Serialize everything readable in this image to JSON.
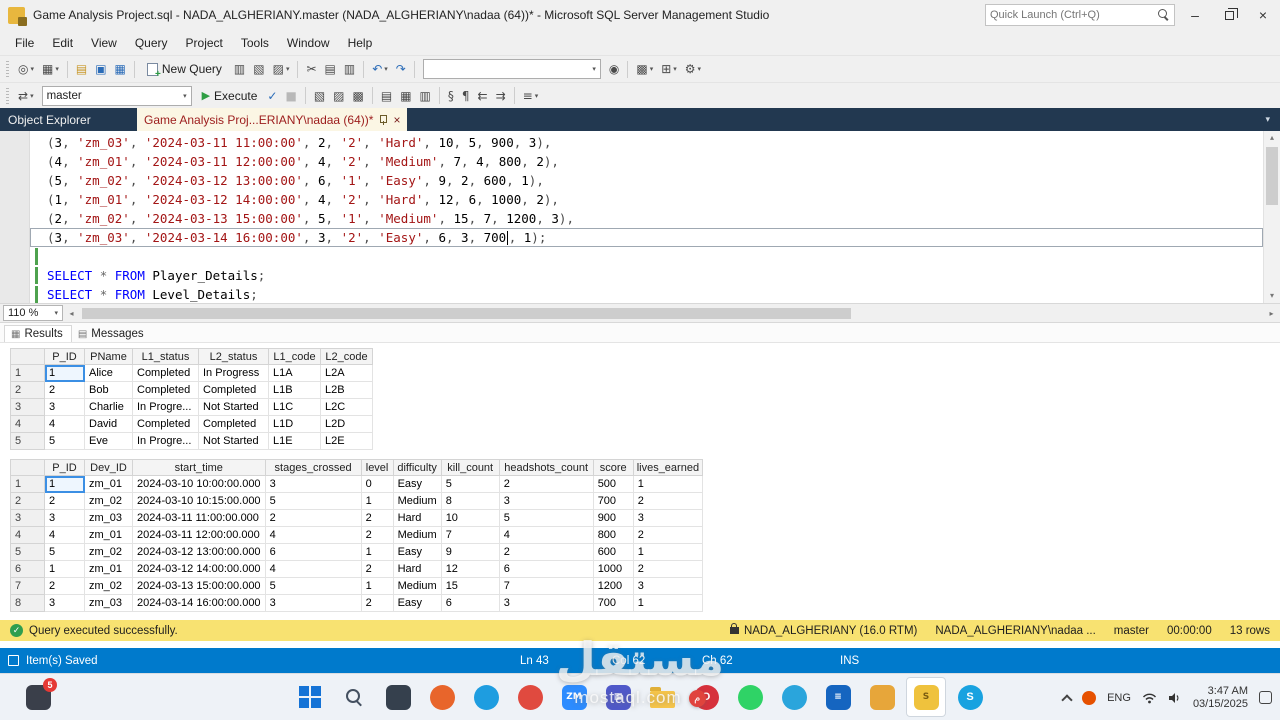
{
  "titlebar": {
    "title": "Game Analysis Project.sql - NADA_ALGHERIANY.master (NADA_ALGHERIANY\\nadaa (64))* - Microsoft SQL Server Management Studio",
    "quick_launch_placeholder": "Quick Launch (Ctrl+Q)"
  },
  "menu": {
    "items": [
      "File",
      "Edit",
      "View",
      "Query",
      "Project",
      "Tools",
      "Window",
      "Help"
    ]
  },
  "toolbar_main": {
    "new_query_label": "New Query",
    "icons_a": [
      {
        "name": "connect-icon",
        "glyph": "◎",
        "dd": true
      },
      {
        "name": "register-server-icon",
        "glyph": "▦",
        "dd": true
      },
      {
        "sep": true
      },
      {
        "name": "open-file-icon",
        "glyph": "▤",
        "color": "#c9982a"
      },
      {
        "name": "save-icon",
        "glyph": "▣",
        "color": "#2b6cb8"
      },
      {
        "name": "save-all-icon",
        "glyph": "▦",
        "color": "#2b6cb8"
      },
      {
        "sep": true
      }
    ],
    "icons_b": [
      {
        "name": "new-database-query-icon",
        "glyph": "▥"
      },
      {
        "name": "open-query-icon",
        "glyph": "▧"
      },
      {
        "name": "analysis-query-icon",
        "glyph": "▨",
        "dd": true
      },
      {
        "sep": true
      },
      {
        "name": "cut-icon",
        "glyph": "✂"
      },
      {
        "name": "copy-icon",
        "glyph": "▤"
      },
      {
        "name": "paste-icon",
        "glyph": "▥"
      },
      {
        "sep": true
      },
      {
        "name": "undo-icon",
        "glyph": "↶",
        "color": "#2b6cb8",
        "dd": true
      },
      {
        "name": "redo-icon",
        "glyph": "↷",
        "color": "#2b6cb8"
      },
      {
        "sep": true
      }
    ],
    "icons_c": [
      {
        "name": "find-icon",
        "glyph": "◉"
      },
      {
        "sep": true
      },
      {
        "name": "activity-monitor-icon",
        "glyph": "▩",
        "dd": true
      },
      {
        "name": "feature-pane-icon",
        "glyph": "⊞",
        "dd": true
      },
      {
        "name": "settings-icon",
        "glyph": "⚙",
        "dd": true
      }
    ]
  },
  "toolbar_query": {
    "database": "master",
    "execute_label": "Execute",
    "icons_a": [
      {
        "name": "available-databases-icon",
        "glyph": "⇄",
        "dd": true
      }
    ],
    "icons_b": [
      {
        "name": "parse-query-icon",
        "glyph": "✓",
        "color": "#2b6cb8"
      },
      {
        "name": "cancel-query-icon",
        "glyph": "■",
        "color": "#b8b8b8"
      },
      {
        "sep": true
      },
      {
        "name": "estimated-plan-icon",
        "glyph": "▧"
      },
      {
        "name": "live-query-stats-icon",
        "glyph": "▨"
      },
      {
        "name": "client-statistics-icon",
        "glyph": "▩"
      },
      {
        "sep": true
      },
      {
        "name": "results-to-text-icon",
        "glyph": "▤"
      },
      {
        "name": "results-to-grid-icon",
        "glyph": "▦"
      },
      {
        "name": "results-to-file-icon",
        "glyph": "▥"
      },
      {
        "sep": true
      },
      {
        "name": "comment-icon",
        "glyph": "§"
      },
      {
        "name": "uncomment-icon",
        "glyph": "¶"
      },
      {
        "name": "outdent-icon",
        "glyph": "⇇"
      },
      {
        "name": "indent-icon",
        "glyph": "⇉"
      },
      {
        "sep": true
      },
      {
        "name": "sqlcmd-mode-icon",
        "glyph": "≡",
        "dd": true
      }
    ]
  },
  "tabstrip": {
    "object_explorer": "Object Explorer",
    "document_tab": "Game Analysis Proj...ERIANY\\nadaa (64))*"
  },
  "editor": {
    "zoom": "110 %",
    "lines": [
      {
        "tokens": [
          [
            "p",
            "("
          ],
          [
            "n",
            "3"
          ],
          [
            "p",
            ", "
          ],
          [
            "s",
            "'zm_03'"
          ],
          [
            "p",
            ", "
          ],
          [
            "s",
            "'2024-03-11 11:00:00'"
          ],
          [
            "p",
            ", "
          ],
          [
            "n",
            "2"
          ],
          [
            "p",
            ", "
          ],
          [
            "s",
            "'2'"
          ],
          [
            "p",
            ", "
          ],
          [
            "s",
            "'Hard'"
          ],
          [
            "p",
            ", "
          ],
          [
            "n",
            "10"
          ],
          [
            "p",
            ", "
          ],
          [
            "n",
            "5"
          ],
          [
            "p",
            ", "
          ],
          [
            "n",
            "900"
          ],
          [
            "p",
            ", "
          ],
          [
            "n",
            "3"
          ],
          [
            "p",
            "),"
          ]
        ]
      },
      {
        "tokens": [
          [
            "p",
            "("
          ],
          [
            "n",
            "4"
          ],
          [
            "p",
            ", "
          ],
          [
            "s",
            "'zm_01'"
          ],
          [
            "p",
            ", "
          ],
          [
            "s",
            "'2024-03-11 12:00:00'"
          ],
          [
            "p",
            ", "
          ],
          [
            "n",
            "4"
          ],
          [
            "p",
            ", "
          ],
          [
            "s",
            "'2'"
          ],
          [
            "p",
            ", "
          ],
          [
            "s",
            "'Medium'"
          ],
          [
            "p",
            ", "
          ],
          [
            "n",
            "7"
          ],
          [
            "p",
            ", "
          ],
          [
            "n",
            "4"
          ],
          [
            "p",
            ", "
          ],
          [
            "n",
            "800"
          ],
          [
            "p",
            ", "
          ],
          [
            "n",
            "2"
          ],
          [
            "p",
            "),"
          ]
        ]
      },
      {
        "tokens": [
          [
            "p",
            "("
          ],
          [
            "n",
            "5"
          ],
          [
            "p",
            ", "
          ],
          [
            "s",
            "'zm_02'"
          ],
          [
            "p",
            ", "
          ],
          [
            "s",
            "'2024-03-12 13:00:00'"
          ],
          [
            "p",
            ", "
          ],
          [
            "n",
            "6"
          ],
          [
            "p",
            ", "
          ],
          [
            "s",
            "'1'"
          ],
          [
            "p",
            ", "
          ],
          [
            "s",
            "'Easy'"
          ],
          [
            "p",
            ", "
          ],
          [
            "n",
            "9"
          ],
          [
            "p",
            ", "
          ],
          [
            "n",
            "2"
          ],
          [
            "p",
            ", "
          ],
          [
            "n",
            "600"
          ],
          [
            "p",
            ", "
          ],
          [
            "n",
            "1"
          ],
          [
            "p",
            "),"
          ]
        ]
      },
      {
        "tokens": [
          [
            "p",
            "("
          ],
          [
            "n",
            "1"
          ],
          [
            "p",
            ", "
          ],
          [
            "s",
            "'zm_01'"
          ],
          [
            "p",
            ", "
          ],
          [
            "s",
            "'2024-03-12 14:00:00'"
          ],
          [
            "p",
            ", "
          ],
          [
            "n",
            "4"
          ],
          [
            "p",
            ", "
          ],
          [
            "s",
            "'2'"
          ],
          [
            "p",
            ", "
          ],
          [
            "s",
            "'Hard'"
          ],
          [
            "p",
            ", "
          ],
          [
            "n",
            "12"
          ],
          [
            "p",
            ", "
          ],
          [
            "n",
            "6"
          ],
          [
            "p",
            ", "
          ],
          [
            "n",
            "1000"
          ],
          [
            "p",
            ", "
          ],
          [
            "n",
            "2"
          ],
          [
            "p",
            "),"
          ]
        ]
      },
      {
        "tokens": [
          [
            "p",
            "("
          ],
          [
            "n",
            "2"
          ],
          [
            "p",
            ", "
          ],
          [
            "s",
            "'zm_02'"
          ],
          [
            "p",
            ", "
          ],
          [
            "s",
            "'2024-03-13 15:00:00'"
          ],
          [
            "p",
            ", "
          ],
          [
            "n",
            "5"
          ],
          [
            "p",
            ", "
          ],
          [
            "s",
            "'1'"
          ],
          [
            "p",
            ", "
          ],
          [
            "s",
            "'Medium'"
          ],
          [
            "p",
            ", "
          ],
          [
            "n",
            "15"
          ],
          [
            "p",
            ", "
          ],
          [
            "n",
            "7"
          ],
          [
            "p",
            ", "
          ],
          [
            "n",
            "1200"
          ],
          [
            "p",
            ", "
          ],
          [
            "n",
            "3"
          ],
          [
            "p",
            "),"
          ]
        ]
      },
      {
        "current": true,
        "tokens": [
          [
            "p",
            "("
          ],
          [
            "n",
            "3"
          ],
          [
            "p",
            ", "
          ],
          [
            "s",
            "'zm_03'"
          ],
          [
            "p",
            ", "
          ],
          [
            "s",
            "'2024-03-14 16:00:00'"
          ],
          [
            "p",
            ", "
          ],
          [
            "n",
            "3"
          ],
          [
            "p",
            ", "
          ],
          [
            "s",
            "'2'"
          ],
          [
            "p",
            ", "
          ],
          [
            "s",
            "'Easy'"
          ],
          [
            "p",
            ", "
          ],
          [
            "n",
            "6"
          ],
          [
            "p",
            ", "
          ],
          [
            "n",
            "3"
          ],
          [
            "p",
            ", "
          ],
          [
            "n",
            "700"
          ],
          [
            "cur",
            ""
          ],
          [
            "p",
            ", "
          ],
          [
            "n",
            "1"
          ],
          [
            "p",
            ");"
          ]
        ]
      },
      {
        "green": true,
        "tokens": []
      },
      {
        "green": true,
        "tokens": [
          [
            "k",
            "SELECT"
          ],
          [
            "w",
            " "
          ],
          [
            "o",
            "*"
          ],
          [
            "w",
            " "
          ],
          [
            "k",
            "FROM"
          ],
          [
            "i",
            " Player_Details"
          ],
          [
            "p",
            ";"
          ]
        ]
      },
      {
        "green": true,
        "tokens": [
          [
            "k",
            "SELECT"
          ],
          [
            "w",
            " "
          ],
          [
            "o",
            "*"
          ],
          [
            "w",
            " "
          ],
          [
            "k",
            "FROM"
          ],
          [
            "i",
            " Level_Details"
          ],
          [
            "p",
            ";"
          ]
        ]
      }
    ]
  },
  "results": {
    "tabs": [
      "Results",
      "Messages"
    ],
    "grid1": {
      "headers": [
        "P_ID",
        "PName",
        "L1_status",
        "L2_status",
        "L1_code",
        "L2_code"
      ],
      "rows": [
        [
          "1",
          "Alice",
          "Completed",
          "In Progress",
          "L1A",
          "L2A"
        ],
        [
          "2",
          "Bob",
          "Completed",
          "Completed",
          "L1B",
          "L2B"
        ],
        [
          "3",
          "Charlie",
          "In Progre...",
          "Not Started",
          "L1C",
          "L2C"
        ],
        [
          "4",
          "David",
          "Completed",
          "Completed",
          "L1D",
          "L2D"
        ],
        [
          "5",
          "Eve",
          "In Progre...",
          "Not Started",
          "L1E",
          "L2E"
        ]
      ]
    },
    "grid2": {
      "headers": [
        "P_ID",
        "Dev_ID",
        "start_time",
        "stages_crossed",
        "level",
        "difficulty",
        "kill_count",
        "headshots_count",
        "score",
        "lives_earned"
      ],
      "rows": [
        [
          "1",
          "zm_01",
          "2024-03-10 10:00:00.000",
          "3",
          "0",
          "Easy",
          "5",
          "2",
          "500",
          "1"
        ],
        [
          "2",
          "zm_02",
          "2024-03-10 10:15:00.000",
          "5",
          "1",
          "Medium",
          "8",
          "3",
          "700",
          "2"
        ],
        [
          "3",
          "zm_03",
          "2024-03-11 11:00:00.000",
          "2",
          "2",
          "Hard",
          "10",
          "5",
          "900",
          "3"
        ],
        [
          "4",
          "zm_01",
          "2024-03-11 12:00:00.000",
          "4",
          "2",
          "Medium",
          "7",
          "4",
          "800",
          "2"
        ],
        [
          "5",
          "zm_02",
          "2024-03-12 13:00:00.000",
          "6",
          "1",
          "Easy",
          "9",
          "2",
          "600",
          "1"
        ],
        [
          "1",
          "zm_01",
          "2024-03-12 14:00:00.000",
          "4",
          "2",
          "Hard",
          "12",
          "6",
          "1000",
          "2"
        ],
        [
          "2",
          "zm_02",
          "2024-03-13 15:00:00.000",
          "5",
          "1",
          "Medium",
          "15",
          "7",
          "1200",
          "3"
        ],
        [
          "3",
          "zm_03",
          "2024-03-14 16:00:00.000",
          "3",
          "2",
          "Easy",
          "6",
          "3",
          "700",
          "1"
        ]
      ]
    }
  },
  "status_yellow": {
    "message": "Query executed successfully.",
    "server": "NADA_ALGHERIANY (16.0 RTM)",
    "user": "NADA_ALGHERIANY\\nadaa ...",
    "database": "master",
    "time": "00:00:00",
    "rows": "13 rows"
  },
  "status_blue": {
    "left": "Item(s) Saved",
    "ln": "Ln 43",
    "col": "Col 62",
    "ch": "Ch 62",
    "mode": "INS"
  },
  "taskbar": {
    "badge": "5",
    "lang": "ENG",
    "time": "3:47 AM",
    "date": "03/15/2025",
    "apps": [
      {
        "name": "taskbar-start-button",
        "kind": "win"
      },
      {
        "name": "taskbar-search-button",
        "kind": "search"
      },
      {
        "name": "taskbar-taskview-icon",
        "kind": "square",
        "c": "#35404d",
        "letter": ""
      },
      {
        "name": "taskbar-firefox-icon",
        "kind": "circle",
        "c": "#e8652b",
        "letter": ""
      },
      {
        "name": "taskbar-edge-icon",
        "kind": "circle",
        "c": "#1e9de0",
        "letter": ""
      },
      {
        "name": "taskbar-chrome-icon",
        "kind": "circle",
        "c": "#e04a3f",
        "letter": ""
      },
      {
        "name": "taskbar-zoom-icon",
        "kind": "square",
        "c": "#2d8cff",
        "letter": "ZM"
      },
      {
        "name": "taskbar-teams-icon",
        "kind": "square",
        "c": "#5059c9",
        "letter": "▦"
      },
      {
        "name": "taskbar-explorer-icon",
        "kind": "folder"
      },
      {
        "name": "taskbar-opera-icon",
        "kind": "circle",
        "c": "#d6313c",
        "letter": "O"
      },
      {
        "name": "taskbar-whatsapp-icon",
        "kind": "circle",
        "c": "#2fd366",
        "letter": ""
      },
      {
        "name": "taskbar-telegram-icon",
        "kind": "circle",
        "c": "#2aa5dc",
        "letter": ""
      },
      {
        "name": "taskbar-notes-app-icon",
        "kind": "square",
        "c": "#1565c0",
        "letter": "≡"
      },
      {
        "name": "taskbar-photos-app-icon",
        "kind": "square",
        "c": "#e7a63a",
        "letter": ""
      },
      {
        "name": "taskbar-ssms-icon",
        "kind": "square",
        "c": "#efc23d",
        "fg": "#7a5b10",
        "letter": "S",
        "active": true
      },
      {
        "name": "taskbar-skype-icon",
        "kind": "circle",
        "c": "#18a2e0",
        "letter": "S"
      }
    ]
  },
  "watermark": {
    "text_ar": "مستقل",
    "domain": "mostaql.com"
  }
}
